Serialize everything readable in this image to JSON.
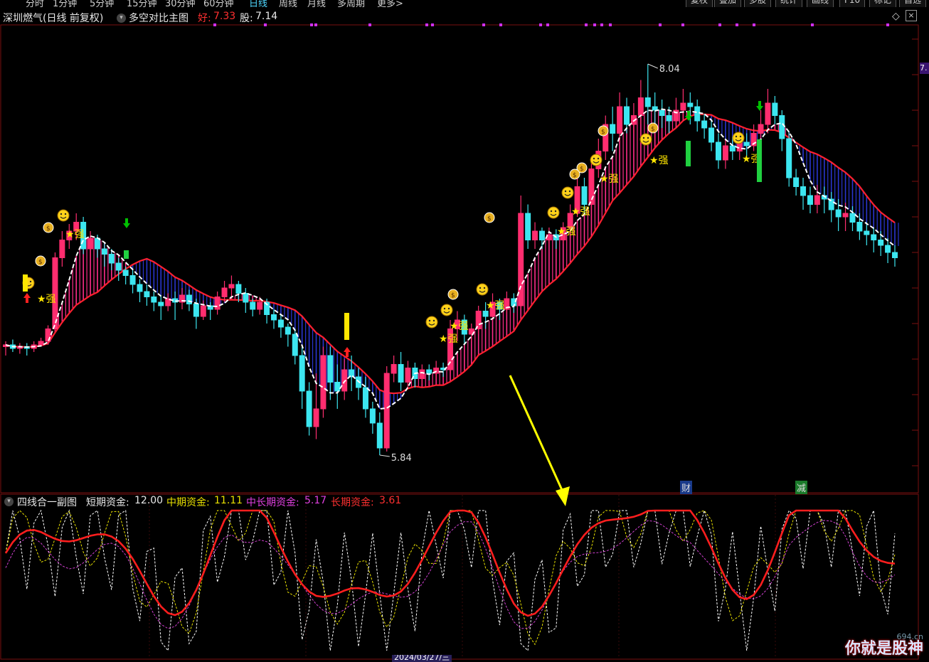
{
  "topbar": {
    "periods": [
      "分时",
      "1分钟",
      "5分钟",
      "15分钟",
      "30分钟",
      "60分钟",
      "日线",
      "周线",
      "月线",
      "多周期",
      "更多>"
    ],
    "active_period": "日线",
    "tools": [
      "复权",
      "叠加",
      "多股",
      "统计",
      "画线",
      "F10",
      "标记",
      "自选"
    ]
  },
  "header": {
    "stock_name": "深圳燃气(日线 前复权)",
    "indicator_name": "多空对比主图",
    "good_label": "好:",
    "good_value": "7.33",
    "stock_label": "股:",
    "stock_value": "7.14",
    "right_badge": "7."
  },
  "main_chart": {
    "high_label": "8.04",
    "low_label": "5.84",
    "strong_label": "★强",
    "fin_tag": "财",
    "reduce_tag": "减",
    "colors": {
      "up": "#ff2d6f",
      "down": "#3ce6f0",
      "band_up": "#ff2d8a",
      "band_down": "#2a36d0",
      "ma": "#ffffff",
      "signal": "#ffe600",
      "buy": "#ff2020",
      "sell": "#00c000"
    }
  },
  "sub_chart": {
    "title": "四线合一副图",
    "short_label": "短期资金:",
    "short_value": "12.00",
    "mid_label": "中期资金:",
    "mid_value": "11.11",
    "midlong_label": "中长期资金:",
    "midlong_value": "5.17",
    "long_label": "长期资金:",
    "long_value": "3.61",
    "colors": {
      "short": "#ffffff",
      "mid": "#e8e000",
      "midlong": "#d040d0",
      "long": "#ff1e1e"
    }
  },
  "bottom": {
    "date_label": "2024/03/27/三",
    "watermark": "你就是股神",
    "site": "694.cn"
  },
  "chart_data": {
    "type": "candlestick",
    "price_high": 8.04,
    "price_low": 5.84,
    "candles": [
      [
        6.45,
        6.46,
        6.4,
        6.48
      ],
      [
        6.46,
        6.44,
        6.42,
        6.49
      ],
      [
        6.44,
        6.45,
        6.41,
        6.47
      ],
      [
        6.45,
        6.44,
        6.4,
        6.47
      ],
      [
        6.44,
        6.46,
        6.42,
        6.48
      ],
      [
        6.46,
        6.48,
        6.45,
        6.5
      ],
      [
        6.48,
        6.55,
        6.46,
        6.57
      ],
      [
        6.55,
        6.95,
        6.54,
        6.98
      ],
      [
        6.95,
        7.05,
        6.9,
        7.1
      ],
      [
        7.05,
        7.1,
        7.0,
        7.14
      ],
      [
        7.1,
        7.15,
        7.05,
        7.2
      ],
      [
        7.15,
        7.0,
        6.97,
        7.18
      ],
      [
        7.0,
        7.06,
        6.95,
        7.1
      ],
      [
        7.06,
        7.0,
        6.95,
        7.08
      ],
      [
        7.0,
        6.97,
        6.9,
        7.03
      ],
      [
        6.97,
        6.92,
        6.88,
        7.0
      ],
      [
        6.92,
        6.88,
        6.82,
        6.95
      ],
      [
        6.88,
        6.85,
        6.8,
        6.9
      ],
      [
        6.85,
        6.8,
        6.75,
        6.88
      ],
      [
        6.8,
        6.76,
        6.7,
        6.83
      ],
      [
        6.76,
        6.73,
        6.68,
        6.8
      ],
      [
        6.73,
        6.7,
        6.65,
        6.76
      ],
      [
        6.7,
        6.68,
        6.6,
        6.74
      ],
      [
        6.68,
        6.72,
        6.65,
        6.75
      ],
      [
        6.72,
        6.7,
        6.6,
        6.76
      ],
      [
        6.7,
        6.74,
        6.66,
        6.78
      ],
      [
        6.74,
        6.69,
        6.65,
        6.77
      ],
      [
        6.69,
        6.62,
        6.55,
        6.72
      ],
      [
        6.62,
        6.68,
        6.6,
        6.71
      ],
      [
        6.68,
        6.66,
        6.6,
        6.7
      ],
      [
        6.66,
        6.73,
        6.63,
        6.76
      ],
      [
        6.73,
        6.78,
        6.7,
        6.82
      ],
      [
        6.78,
        6.8,
        6.72,
        6.85
      ],
      [
        6.8,
        6.75,
        6.7,
        6.82
      ],
      [
        6.75,
        6.7,
        6.64,
        6.78
      ],
      [
        6.7,
        6.66,
        6.62,
        6.72
      ],
      [
        6.66,
        6.7,
        6.63,
        6.73
      ],
      [
        6.7,
        6.63,
        6.58,
        6.72
      ],
      [
        6.63,
        6.6,
        6.55,
        6.66
      ],
      [
        6.6,
        6.56,
        6.5,
        6.63
      ],
      [
        6.56,
        6.52,
        6.45,
        6.58
      ],
      [
        6.52,
        6.4,
        6.35,
        6.55
      ],
      [
        6.4,
        6.2,
        6.1,
        6.45
      ],
      [
        6.2,
        6.0,
        5.95,
        6.25
      ],
      [
        6.0,
        6.1,
        5.93,
        6.3
      ],
      [
        6.1,
        6.4,
        6.05,
        6.45
      ],
      [
        6.4,
        6.25,
        6.15,
        6.45
      ],
      [
        6.25,
        6.2,
        6.1,
        6.35
      ],
      [
        6.2,
        6.32,
        6.15,
        6.38
      ],
      [
        6.32,
        6.28,
        6.2,
        6.4
      ],
      [
        6.28,
        6.22,
        6.15,
        6.33
      ],
      [
        6.22,
        6.1,
        6.05,
        6.28
      ],
      [
        6.1,
        6.02,
        5.96,
        6.14
      ],
      [
        6.02,
        5.88,
        5.84,
        6.08
      ],
      [
        5.88,
        6.3,
        5.86,
        6.34
      ],
      [
        6.3,
        6.35,
        6.25,
        6.4
      ],
      [
        6.35,
        6.25,
        6.2,
        6.42
      ],
      [
        6.25,
        6.33,
        6.22,
        6.37
      ],
      [
        6.33,
        6.27,
        6.22,
        6.36
      ],
      [
        6.27,
        6.32,
        6.24,
        6.35
      ],
      [
        6.32,
        6.3,
        6.26,
        6.35
      ],
      [
        6.3,
        6.33,
        6.27,
        6.37
      ],
      [
        6.33,
        6.32,
        6.28,
        6.36
      ],
      [
        6.32,
        6.55,
        6.3,
        6.6
      ],
      [
        6.55,
        6.6,
        6.48,
        6.65
      ],
      [
        6.6,
        6.52,
        6.47,
        6.63
      ],
      [
        6.52,
        6.55,
        6.48,
        6.58
      ],
      [
        6.55,
        6.65,
        6.52,
        6.68
      ],
      [
        6.65,
        6.62,
        6.55,
        6.7
      ],
      [
        6.62,
        6.7,
        6.6,
        6.75
      ],
      [
        6.7,
        6.66,
        6.6,
        6.72
      ],
      [
        6.66,
        6.72,
        6.63,
        6.76
      ],
      [
        6.72,
        6.68,
        6.64,
        6.75
      ],
      [
        6.68,
        7.2,
        6.66,
        7.3
      ],
      [
        7.2,
        7.05,
        7.0,
        7.25
      ],
      [
        7.05,
        7.1,
        7.0,
        7.15
      ],
      [
        7.1,
        7.05,
        7.0,
        7.12
      ],
      [
        7.05,
        7.08,
        7.02,
        7.12
      ],
      [
        7.08,
        7.05,
        7.0,
        7.11
      ],
      [
        7.05,
        7.12,
        7.03,
        7.15
      ],
      [
        7.12,
        7.2,
        7.1,
        7.25
      ],
      [
        7.2,
        7.35,
        7.18,
        7.4
      ],
      [
        7.35,
        7.25,
        7.2,
        7.4
      ],
      [
        7.25,
        7.45,
        7.22,
        7.5
      ],
      [
        7.45,
        7.55,
        7.4,
        7.62
      ],
      [
        7.55,
        7.7,
        7.5,
        7.75
      ],
      [
        7.7,
        7.65,
        7.55,
        7.8
      ],
      [
        7.65,
        7.8,
        7.6,
        7.88
      ],
      [
        7.8,
        7.7,
        7.65,
        7.85
      ],
      [
        7.7,
        7.75,
        7.65,
        7.82
      ],
      [
        7.75,
        7.85,
        7.7,
        7.95
      ],
      [
        7.85,
        7.8,
        7.7,
        8.04
      ],
      [
        7.8,
        7.78,
        7.7,
        7.88
      ],
      [
        7.78,
        7.75,
        7.68,
        7.84
      ],
      [
        7.75,
        7.72,
        7.65,
        7.8
      ],
      [
        7.72,
        7.78,
        7.68,
        7.85
      ],
      [
        7.78,
        7.82,
        7.72,
        7.9
      ],
      [
        7.82,
        7.8,
        7.7,
        7.88
      ],
      [
        7.8,
        7.72,
        7.66,
        7.84
      ],
      [
        7.72,
        7.68,
        7.62,
        7.76
      ],
      [
        7.68,
        7.6,
        7.55,
        7.72
      ],
      [
        7.6,
        7.5,
        7.45,
        7.65
      ],
      [
        7.5,
        7.58,
        7.45,
        7.62
      ],
      [
        7.58,
        7.55,
        7.5,
        7.63
      ],
      [
        7.55,
        7.6,
        7.5,
        7.66
      ],
      [
        7.6,
        7.58,
        7.52,
        7.65
      ],
      [
        7.58,
        7.65,
        7.55,
        7.7
      ],
      [
        7.65,
        7.7,
        7.6,
        7.78
      ],
      [
        7.7,
        7.82,
        7.65,
        7.9
      ],
      [
        7.82,
        7.75,
        7.7,
        7.86
      ],
      [
        7.75,
        7.62,
        7.55,
        7.78
      ],
      [
        7.62,
        7.4,
        7.35,
        7.66
      ],
      [
        7.4,
        7.35,
        7.3,
        7.45
      ],
      [
        7.35,
        7.3,
        7.22,
        7.4
      ],
      [
        7.3,
        7.25,
        7.2,
        7.35
      ],
      [
        7.25,
        7.3,
        7.2,
        7.36
      ],
      [
        7.3,
        7.28,
        7.2,
        7.35
      ],
      [
        7.28,
        7.22,
        7.15,
        7.32
      ],
      [
        7.22,
        7.18,
        7.1,
        7.28
      ],
      [
        7.18,
        7.2,
        7.1,
        7.26
      ],
      [
        7.2,
        7.15,
        7.1,
        7.24
      ],
      [
        7.15,
        7.1,
        7.05,
        7.2
      ],
      [
        7.1,
        7.08,
        7.02,
        7.15
      ],
      [
        7.08,
        7.05,
        6.98,
        7.12
      ],
      [
        7.05,
        7.02,
        6.96,
        7.1
      ],
      [
        7.02,
        6.98,
        6.92,
        7.06
      ],
      [
        6.98,
        6.95,
        6.9,
        7.02
      ]
    ]
  }
}
